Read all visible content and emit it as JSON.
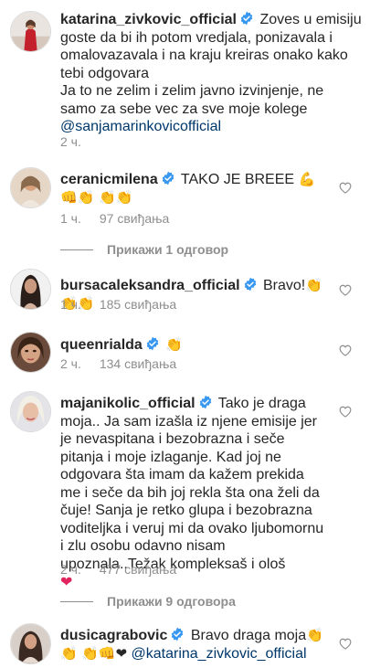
{
  "caption": {
    "username": "katarina_zivkovic_official",
    "text_line1": "Zoves u emisiju",
    "text_rest": "goste da bi ih potom vredjala, ponizavala i omalovazavala i na kraju kreiras onako kako tebi odgovara",
    "text_line_b": "Ja to ne zelim i zelim javno izvinjenje, ne samo za sebe vec za sve moje kolege",
    "mention": "@sanjamarinkovicofficial",
    "time": "2 ч."
  },
  "comments": [
    {
      "username": "ceranicmilena",
      "text": "TAKO JE BREEE",
      "emoji": "💪👊👏 👏👏",
      "time": "1 ч.",
      "likes": "97 свиђања",
      "replies_label": "Прикажи 1 одговор"
    },
    {
      "username": "bursacaleksandra_official",
      "text": "Bravo!",
      "emoji": "👏👏👏",
      "time": "1 ч.",
      "likes": "185 свиђања"
    },
    {
      "username": "queenrialda",
      "text": "",
      "emoji": "👏",
      "time": "2 ч.",
      "likes": "134 свиђања"
    },
    {
      "username": "majanikolic_official",
      "text": "Tako je draga moja.. Ja sam izašla iz njene emisije jer je nevaspitana i bezobrazna i seče pitanja i moje izlaganje. Kad joj ne odgovara šta imam da kažem prekida me i seče da bih joj rekla šta ona želi da čuje! Sanja je retko glupa i bezobrazna voditeljka i veruj mi da ovako ljubomornu i zlu osobu odavno nisam upoznala..Težak kompleksaš i ološ",
      "emoji": "❤",
      "time": "2 ч.",
      "likes": "477 свиђања",
      "replies_label": "Прикажи 9 одговора"
    },
    {
      "username": "dusicagrabovic",
      "text": "Bravo draga moja",
      "emoji": "👏👏",
      "emoji2": "👏👊❤",
      "mention": "@katarina_zivkovic_official"
    }
  ],
  "colors": {
    "verified": "#3897f0",
    "muted": "#8e8e8e",
    "mention": "#00376b",
    "heart_emoji": "#e0245e"
  }
}
